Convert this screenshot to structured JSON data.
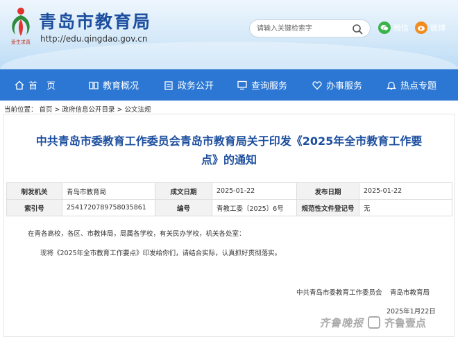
{
  "header": {
    "logo_text": "爱生求真",
    "title": "青岛市教育局",
    "url": "http://edu.qingdao.gov.cn",
    "search_placeholder": "请输入关键检索字",
    "wechat": "微信",
    "weibo": "微博",
    "colors": {
      "brand": "#1d4f9f",
      "nav": "#2b77d3",
      "wechat": "#3cb34a",
      "weibo": "#f28c1e"
    }
  },
  "nav": [
    {
      "label": "首　页",
      "icon": "home-icon"
    },
    {
      "label": "教育概况",
      "icon": "book-icon"
    },
    {
      "label": "政务公开",
      "icon": "clipboard-icon"
    },
    {
      "label": "查询服务",
      "icon": "monitor-icon"
    },
    {
      "label": "办事服务",
      "icon": "heart-icon"
    },
    {
      "label": "热点专题",
      "icon": "bell-icon"
    }
  ],
  "breadcrumb": "当前位置： 首页 > 政府信息公开目录 > 公文法规",
  "article": {
    "title_line1": "中共青岛市委教育工作委员会青岛市教育局关于印发《2025年全市教育工作要",
    "title_line2": "点》的通知",
    "meta": {
      "row1": {
        "k1": "制发机关",
        "v1": "青岛市教育局",
        "k2": "成文日期",
        "v2": "2025-01-22",
        "k3": "发布日期",
        "v3": "2025-01-22"
      },
      "row2": {
        "k1": "索引号",
        "v1": "2541720789758035861",
        "k2": "编号",
        "v2": "青教工委〔2025〕6号",
        "k3": "规范性文件登记号",
        "v3": "无"
      }
    },
    "salutation": "在青各高校，各区、市教体局，局属各学校，有关民办学校，机关各处室：",
    "body": "现将《2025年全市教育工作要点》印发给你们，请结合实际，认真抓好贯彻落实。",
    "sign_org1": "中共青岛市委教育工作委员会",
    "sign_org2": "青岛市教育局",
    "sign_date": "2025年1月22日"
  },
  "watermark": {
    "left": "齐鲁晚报",
    "right": "齐鲁壹点"
  }
}
